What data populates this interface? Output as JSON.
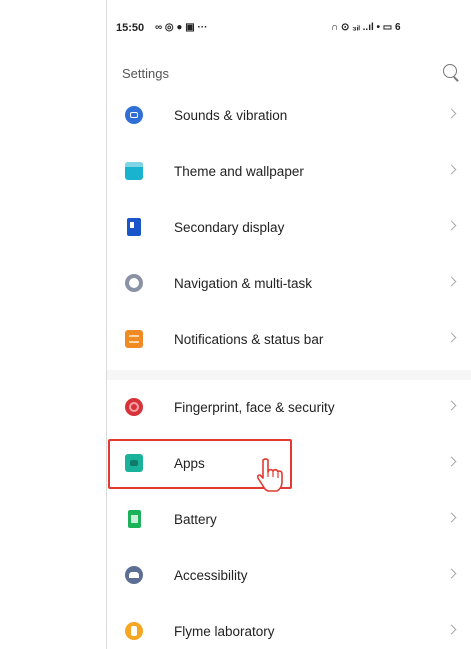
{
  "statusbar": {
    "time": "15:50",
    "left_icons": "∞ ◎ ● ▣ ···",
    "right_icons": "∩ ⊙ ₃ᵢₗ ..ıl • ▭ 6"
  },
  "header": {
    "title": "Settings",
    "search_icon": "search-icon"
  },
  "settings_group_1": [
    {
      "label": "Sounds & vibration",
      "icon": "sound-icon"
    },
    {
      "label": "Theme and wallpaper",
      "icon": "theme-icon"
    },
    {
      "label": "Secondary display",
      "icon": "secondary-display-icon"
    },
    {
      "label": "Navigation & multi-task",
      "icon": "navigation-icon"
    },
    {
      "label": "Notifications & status bar",
      "icon": "notifications-icon"
    }
  ],
  "settings_group_2": [
    {
      "label": "Fingerprint, face & security",
      "icon": "fingerprint-icon"
    },
    {
      "label": "Apps",
      "icon": "apps-icon"
    },
    {
      "label": "Battery",
      "icon": "battery-icon"
    },
    {
      "label": "Accessibility",
      "icon": "accessibility-icon"
    },
    {
      "label": "Flyme laboratory",
      "icon": "flyme-icon"
    }
  ],
  "annotation": {
    "highlight_color": "#e23a32",
    "highlighted_item": "Apps",
    "pointer": "hand-pointer-icon"
  }
}
